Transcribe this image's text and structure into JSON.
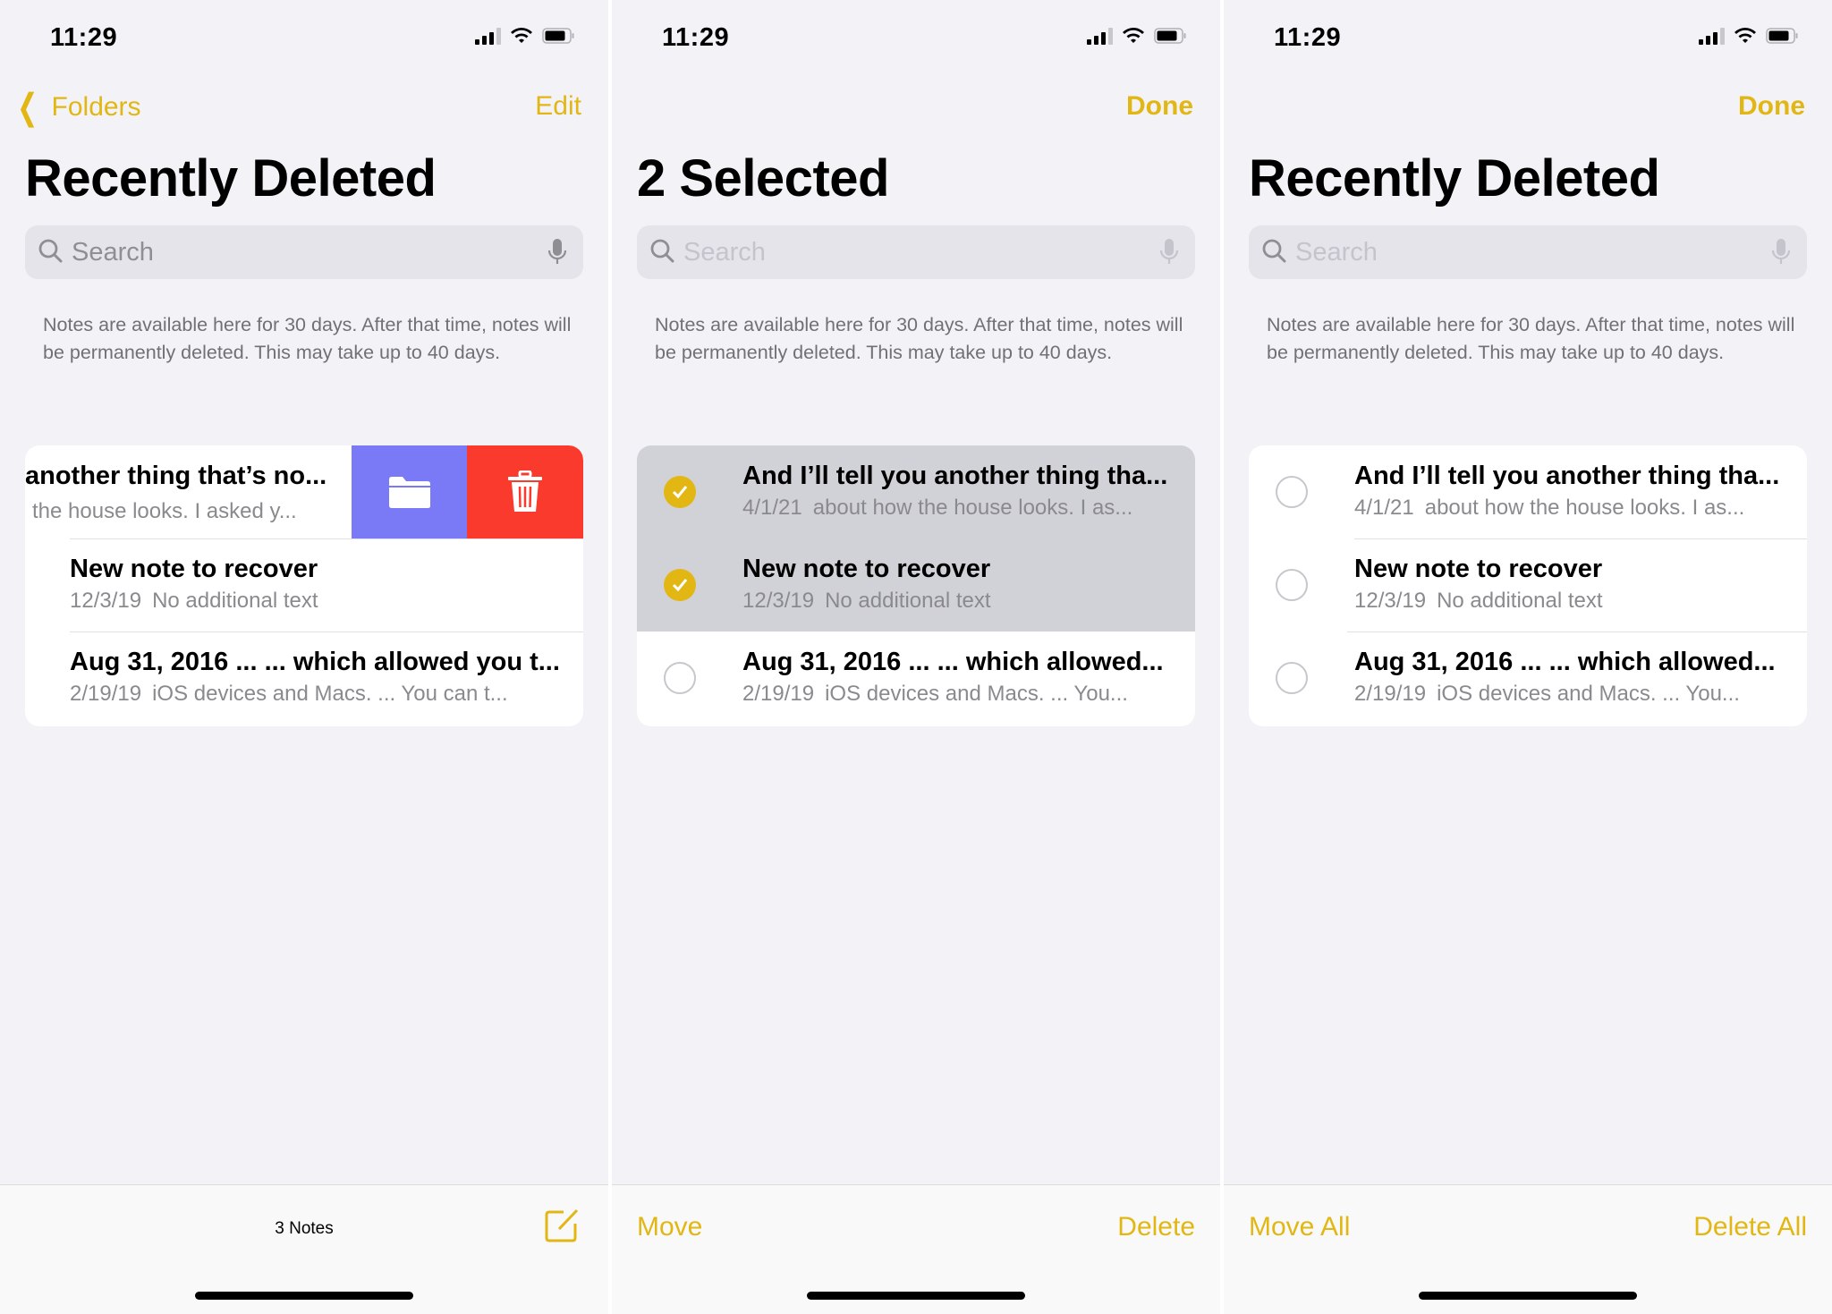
{
  "colors": {
    "accent": "#e2b714",
    "move_action": "#7a7af6",
    "delete_action": "#fb3a2e",
    "selected_row": "#d1d1d8",
    "background": "#f2f2f7"
  },
  "panels": [
    {
      "status": {
        "time": "11:29",
        "icons": [
          "cellular-signal-icon",
          "wifi-icon",
          "battery-icon"
        ]
      },
      "nav": {
        "back_label": "Folders",
        "right_label": "Edit"
      },
      "title": "Recently Deleted",
      "search": {
        "placeholder": "Search"
      },
      "info": "Notes are available here for 30 days. After that time, notes will be permanently deleted. This may take up to 40 days.",
      "notes": [
        {
          "title": "another thing that’s no...",
          "date": "",
          "preview": "the house looks. I asked y...",
          "swiped": true,
          "actions": [
            "folder-icon",
            "trash-icon"
          ]
        },
        {
          "title": "New note to recover",
          "date": "12/3/19",
          "preview": "No additional text"
        },
        {
          "title": "Aug 31, 2016 ... ... which allowed you t...",
          "date": "2/19/19",
          "preview": "iOS devices and Macs. ... You can t..."
        }
      ],
      "toolbar": {
        "count": "3 Notes",
        "right_icon": "compose-icon"
      }
    },
    {
      "status": {
        "time": "11:29",
        "icons": [
          "cellular-signal-icon",
          "wifi-icon",
          "battery-icon"
        ]
      },
      "nav": {
        "right_label": "Done"
      },
      "title": "2 Selected",
      "search": {
        "placeholder": "Search"
      },
      "info": "Notes are available here for 30 days. After that time, notes will be permanently deleted. This may take up to 40 days.",
      "notes": [
        {
          "title": "And I’ll tell you another thing tha...",
          "date": "4/1/21",
          "preview": "about how the house looks. I as...",
          "selected": true
        },
        {
          "title": "New note to recover",
          "date": "12/3/19",
          "preview": "No additional text",
          "selected": true
        },
        {
          "title": "Aug 31, 2016 ... ... which allowed...",
          "date": "2/19/19",
          "preview": "iOS devices and Macs. ... You...",
          "selected": false
        }
      ],
      "toolbar": {
        "left_label": "Move",
        "right_label": "Delete"
      }
    },
    {
      "status": {
        "time": "11:29",
        "icons": [
          "cellular-signal-icon",
          "wifi-icon",
          "battery-icon"
        ]
      },
      "nav": {
        "right_label": "Done"
      },
      "title": "Recently Deleted",
      "search": {
        "placeholder": "Search"
      },
      "info": "Notes are available here for 30 days. After that time, notes will be permanently deleted. This may take up to 40 days.",
      "notes": [
        {
          "title": "And I’ll tell you another thing tha...",
          "date": "4/1/21",
          "preview": "about how the house looks. I as...",
          "selected": false
        },
        {
          "title": "New note to recover",
          "date": "12/3/19",
          "preview": "No additional text",
          "selected": false
        },
        {
          "title": "Aug 31, 2016 ... ... which allowed...",
          "date": "2/19/19",
          "preview": "iOS devices and Macs. ... You...",
          "selected": false
        }
      ],
      "toolbar": {
        "left_label": "Move All",
        "right_label": "Delete All"
      }
    }
  ]
}
